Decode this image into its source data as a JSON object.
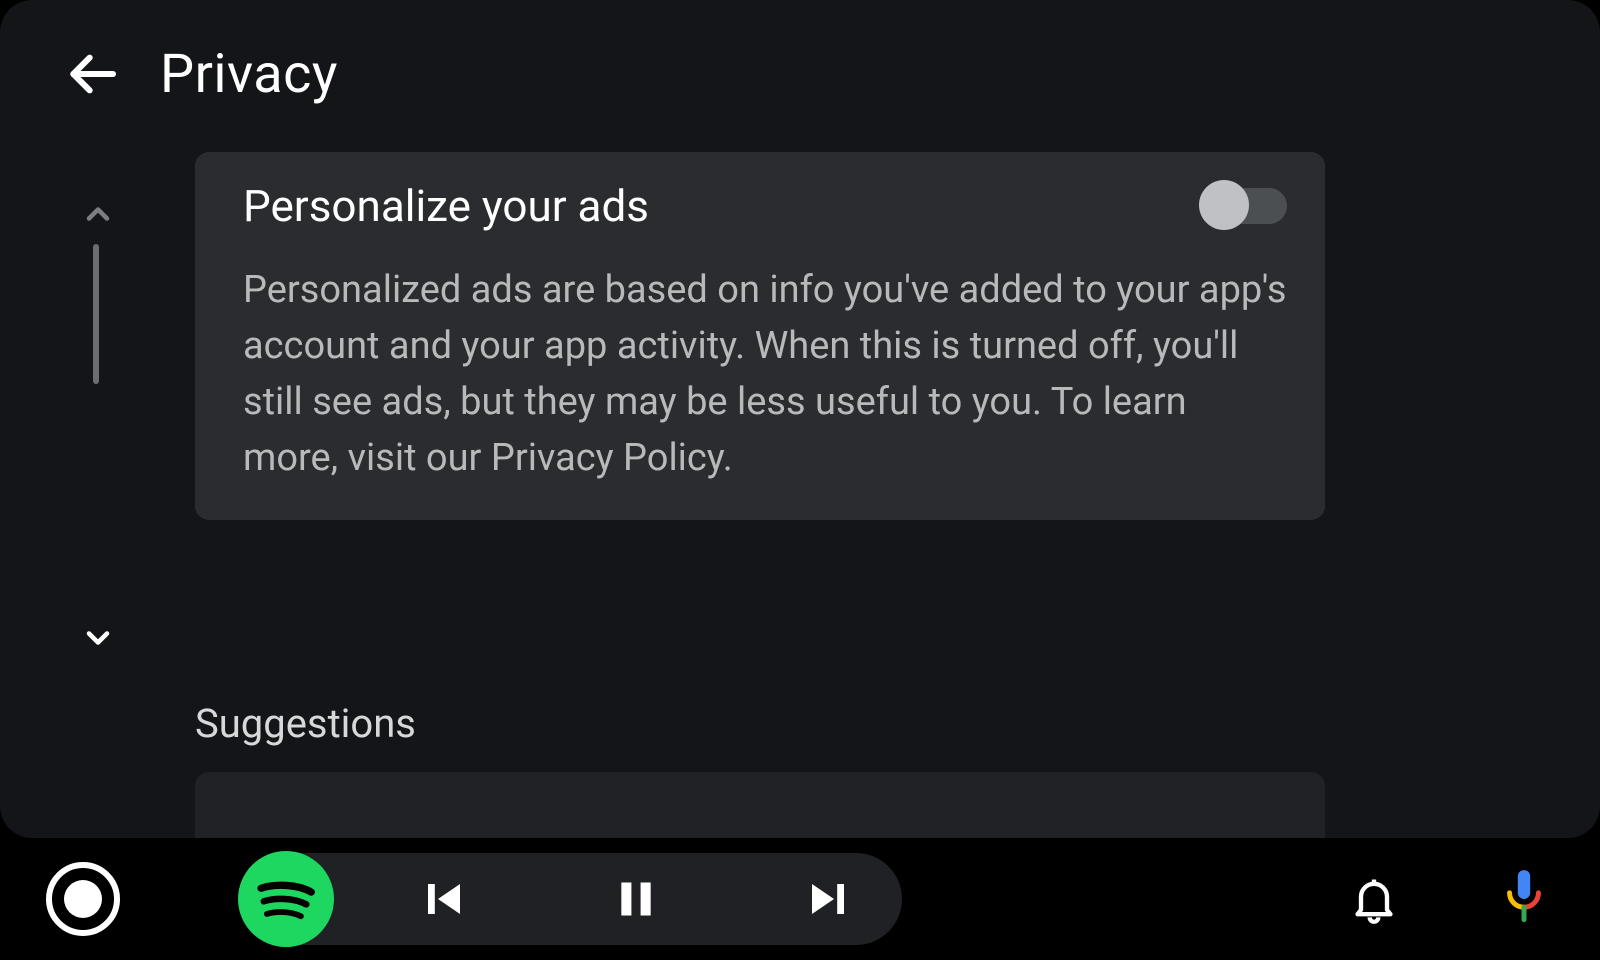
{
  "header": {
    "title": "Privacy"
  },
  "card": {
    "title": "Personalize your ads",
    "description": "Personalized ads are based on info you've added to your app's account and your app activity. When this is turned off, you'll still see ads, but they may be less useful to you. To learn more, visit our Privacy Policy.",
    "toggle": false
  },
  "section": {
    "suggestions_label": "Suggestions"
  },
  "icons": {
    "back": "arrow-left",
    "scroll_up": "chevron-up",
    "scroll_down": "chevron-down",
    "home": "circle-dot",
    "spotify": "spotify",
    "prev": "skip-previous",
    "pause": "pause",
    "next": "skip-next",
    "bell": "bell",
    "mic": "mic"
  },
  "colors": {
    "bg": "#141518",
    "card_bg": "#2a2c2f",
    "pill_bg": "#202124",
    "spotify_green": "#1ed760",
    "desc_text": "#b8b9bb",
    "toggle_track": "#4c4f52",
    "toggle_knob": "#c0c1c4"
  }
}
